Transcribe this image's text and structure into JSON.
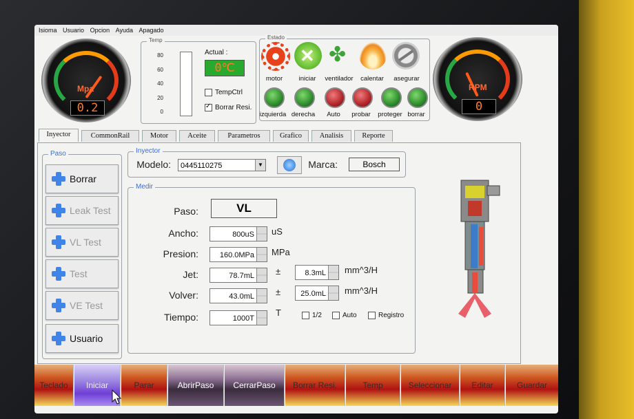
{
  "menu": [
    "Isioma",
    "Usuario",
    "Opcion",
    "Ayuda",
    "Apagado"
  ],
  "pressure_gauge": {
    "unit": "Mpa",
    "reading": "0.2"
  },
  "rpm_gauge": {
    "unit": "RPM",
    "reading": "0"
  },
  "temp": {
    "title": "Temp",
    "ticks": [
      "80",
      "60",
      "40",
      "20",
      "0"
    ],
    "actual_label": "Actual :",
    "actual_value": "0℃",
    "tempctrl_label": "TempCtrl",
    "tempctrl_checked": false,
    "borrar_label": "Borrar Resi.",
    "borrar_checked": true
  },
  "estado": {
    "title": "Estado",
    "icons": [
      {
        "name": "gear-icon",
        "label": "motor",
        "color": "#e8421b"
      },
      {
        "name": "close-circle-icon",
        "label": "iniciar",
        "color": "#6cc23a"
      },
      {
        "name": "fan-icon",
        "label": "ventilador",
        "color": "#43a83a"
      },
      {
        "name": "flame-icon",
        "label": "calentar",
        "color": "#f2a12e"
      },
      {
        "name": "lock-icon",
        "label": "asegurar",
        "color": "#9a9a9a"
      }
    ],
    "leds": [
      {
        "label": "izquierda",
        "color": "#2f8c2e"
      },
      {
        "label": "derecha",
        "color": "#2f8c2e"
      },
      {
        "label": "Auto",
        "color": "#b3262b"
      },
      {
        "label": "probar",
        "color": "#b3262b"
      },
      {
        "label": "proteger",
        "color": "#2f8c2e"
      },
      {
        "label": "borrar",
        "color": "#2f8c2e"
      }
    ]
  },
  "tabs": [
    "Inyector",
    "CommonRail",
    "Motor",
    "Aceite",
    "Parametros",
    "Grafico",
    "Analisis",
    "Reporte"
  ],
  "active_tab": "Inyector",
  "paso_group": {
    "title": "Paso",
    "buttons": [
      {
        "label": "Borrar",
        "enabled": true
      },
      {
        "label": "Leak Test",
        "enabled": false
      },
      {
        "label": "VL Test",
        "enabled": false
      },
      {
        "label": "Test",
        "enabled": false
      },
      {
        "label": "VE Test",
        "enabled": false
      },
      {
        "label": "Usuario",
        "enabled": true
      }
    ]
  },
  "inyector": {
    "title": "Inyector",
    "modelo_label": "Modelo:",
    "modelo_value": "0445110275",
    "marca_label": "Marca:",
    "marca_value": "Bosch"
  },
  "medir": {
    "title": "Medir",
    "paso_label": "Paso:",
    "paso_value": "VL",
    "ancho_label": "Ancho:",
    "ancho_value": "800uS",
    "ancho_unit": "uS",
    "presion_label": "Presion:",
    "presion_value": "160.0MPa",
    "presion_unit": "MPa",
    "jet_label": "Jet:",
    "jet_value": "78.7mL",
    "jet_pm": "±",
    "jet_tol": "8.3mL",
    "jet_unit": "mm^3/H",
    "volver_label": "Volver:",
    "volver_value": "43.0mL",
    "volver_pm": "±",
    "volver_tol": "25.0mL",
    "volver_unit": "mm^3/H",
    "tiempo_label": "Tiempo:",
    "tiempo_value": "1000T",
    "tiempo_unit": "T",
    "half_label": "1/2",
    "auto_label": "Auto",
    "registro_label": "Registro"
  },
  "bottom_buttons": [
    "Teclado",
    "Iniciar",
    "Parar",
    "AbrirPaso",
    "CerrarPaso",
    "Borrar Resi.",
    "Temp",
    "Seleccionar",
    "Editar",
    "Guardar"
  ]
}
